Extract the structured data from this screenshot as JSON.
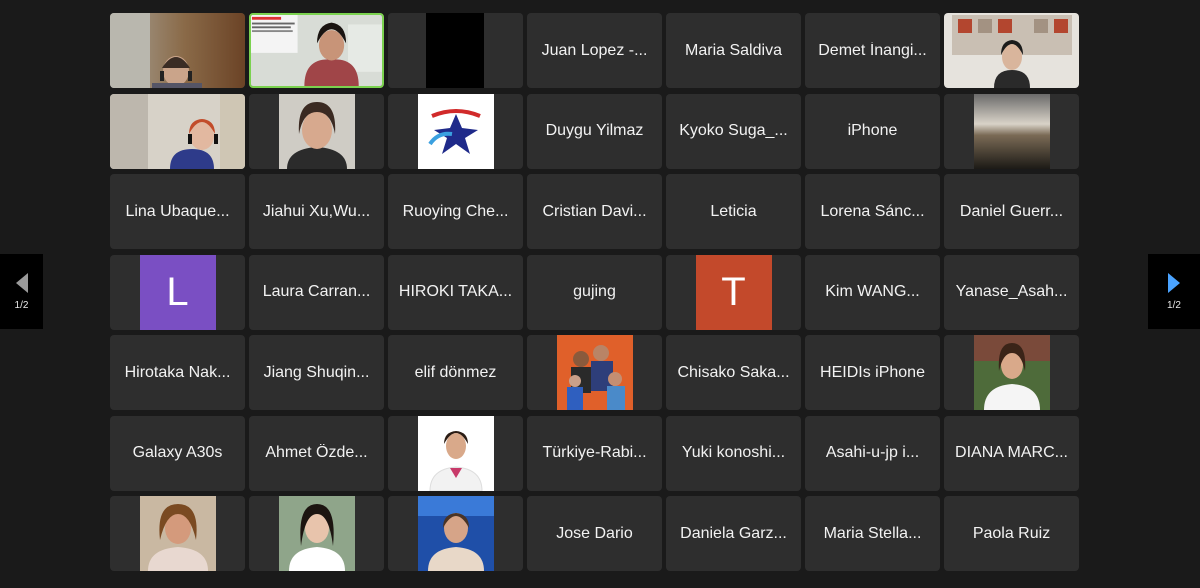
{
  "gallery": {
    "page_indicator_left": "1/2",
    "page_indicator_right": "1/2",
    "participants": [
      {
        "type": "video",
        "scene": "woman-headphones-wood"
      },
      {
        "type": "video",
        "scene": "presenter-slide",
        "active": true,
        "slide_text": "Maternal perceptions of the ... among ... nurses: healthcare and challenges"
      },
      {
        "type": "video",
        "scene": "black-box"
      },
      {
        "type": "name",
        "name": "Juan Lopez -..."
      },
      {
        "type": "name",
        "name": "Maria Saldiva"
      },
      {
        "type": "name",
        "name": "Demet İnangi..."
      },
      {
        "type": "video",
        "scene": "woman-in-room"
      },
      {
        "type": "video",
        "scene": "woman-headphones-redhair"
      },
      {
        "type": "photo",
        "scene": "woman-smiling-gray"
      },
      {
        "type": "photo",
        "scene": "logo-star"
      },
      {
        "type": "name",
        "name": "Duygu Yilmaz"
      },
      {
        "type": "name",
        "name": "Kyoko Suga_..."
      },
      {
        "type": "name",
        "name": "iPhone"
      },
      {
        "type": "photo",
        "scene": "sunset-landscape"
      },
      {
        "type": "name",
        "name": "Lina Ubaque..."
      },
      {
        "type": "name",
        "name": "Jiahui Xu,Wu..."
      },
      {
        "type": "name",
        "name": "Ruoying Che..."
      },
      {
        "type": "name",
        "name": "Cristian Davi..."
      },
      {
        "type": "name",
        "name": "Leticia"
      },
      {
        "type": "name",
        "name": "Lorena Sánc..."
      },
      {
        "type": "name",
        "name": "Daniel Guerr..."
      },
      {
        "type": "avatar",
        "letter": "L",
        "color": "#7a4fc3"
      },
      {
        "type": "name",
        "name": "Laura Carran..."
      },
      {
        "type": "name",
        "name": "HIROKI TAKA..."
      },
      {
        "type": "name",
        "name": "gujing"
      },
      {
        "type": "avatar",
        "letter": "T",
        "color": "#c3492b"
      },
      {
        "type": "name",
        "name": "Kim WANG..."
      },
      {
        "type": "name",
        "name": "Yanase_Asah..."
      },
      {
        "type": "name",
        "name": "Hirotaka Nak..."
      },
      {
        "type": "name",
        "name": "Jiang Shuqin..."
      },
      {
        "type": "name",
        "name": "elif dönmez"
      },
      {
        "type": "photo",
        "scene": "family-orange"
      },
      {
        "type": "name",
        "name": "Chisako Saka..."
      },
      {
        "type": "name",
        "name": "HEIDIs iPhone"
      },
      {
        "type": "photo",
        "scene": "woman-white-coat"
      },
      {
        "type": "name",
        "name": "Galaxy A30s"
      },
      {
        "type": "name",
        "name": "Ahmet Özde..."
      },
      {
        "type": "photo",
        "scene": "woman-white-jacket"
      },
      {
        "type": "name",
        "name": "Türkiye-Rabi..."
      },
      {
        "type": "name",
        "name": "Yuki  konoshi..."
      },
      {
        "type": "name",
        "name": "Asahi-u-jp  i..."
      },
      {
        "type": "name",
        "name": "DIANA MARC..."
      },
      {
        "type": "photo",
        "scene": "woman-blonde"
      },
      {
        "type": "photo",
        "scene": "woman-asian-smiling"
      },
      {
        "type": "photo",
        "scene": "woman-blue-background"
      },
      {
        "type": "name",
        "name": "Jose Dario"
      },
      {
        "type": "name",
        "name": "Daniela Garz..."
      },
      {
        "type": "name",
        "name": "Maria Stella..."
      },
      {
        "type": "name",
        "name": "Paola Ruiz"
      }
    ]
  }
}
